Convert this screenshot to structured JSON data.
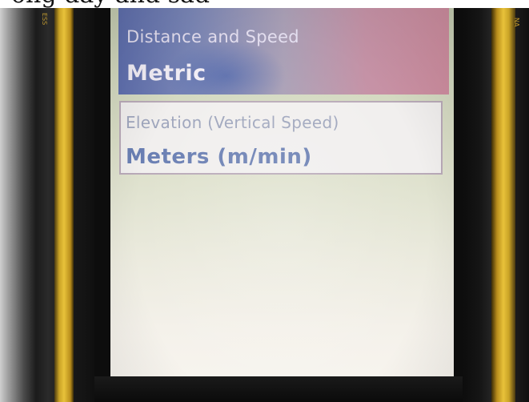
{
  "caption": {
    "text": "ong day and sad"
  },
  "device": {
    "left_side_label": "ESS",
    "right_side_label": "NA"
  },
  "settings": [
    {
      "label": "Distance and Speed",
      "value": "Metric",
      "selected": true
    },
    {
      "label": "Elevation (Vertical Speed)",
      "value": "Meters (m/min)",
      "selected": false
    }
  ],
  "colors": {
    "highlight_start": "#5f6fae",
    "highlight_end": "#cf8ea0",
    "value_text": "#6a7fb3",
    "device_accent": "#e8c23a"
  }
}
